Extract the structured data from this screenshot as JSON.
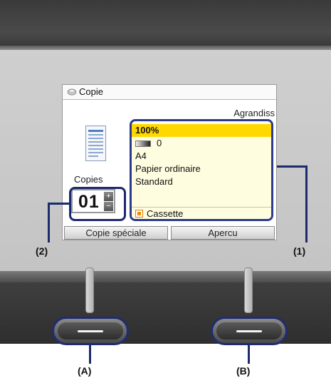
{
  "lcd": {
    "title": "Copie",
    "zoom_label": "Agrandiss",
    "copies_label": "Copies",
    "copies_value": "01",
    "stepper_plus": "+",
    "stepper_minus": "−"
  },
  "settings": {
    "rows": [
      {
        "label": "100%",
        "selected": true
      },
      {
        "label": "0"
      },
      {
        "label": "A4"
      },
      {
        "label": "Papier ordinaire"
      },
      {
        "label": "Standard"
      }
    ],
    "source": "Cassette"
  },
  "function_buttons": {
    "left": "Copie spéciale",
    "right": "Apercu"
  },
  "callouts": {
    "one": "(1)",
    "two": "(2)",
    "a": "(A)",
    "b": "(B)"
  },
  "colors": {
    "highlight": "#ffd800",
    "panel_bg": "#fffde0",
    "callout_line": "#1c2a6e"
  },
  "icons": [
    "copy-mode-icon",
    "document-icon",
    "density-icon",
    "cassette-icon"
  ]
}
